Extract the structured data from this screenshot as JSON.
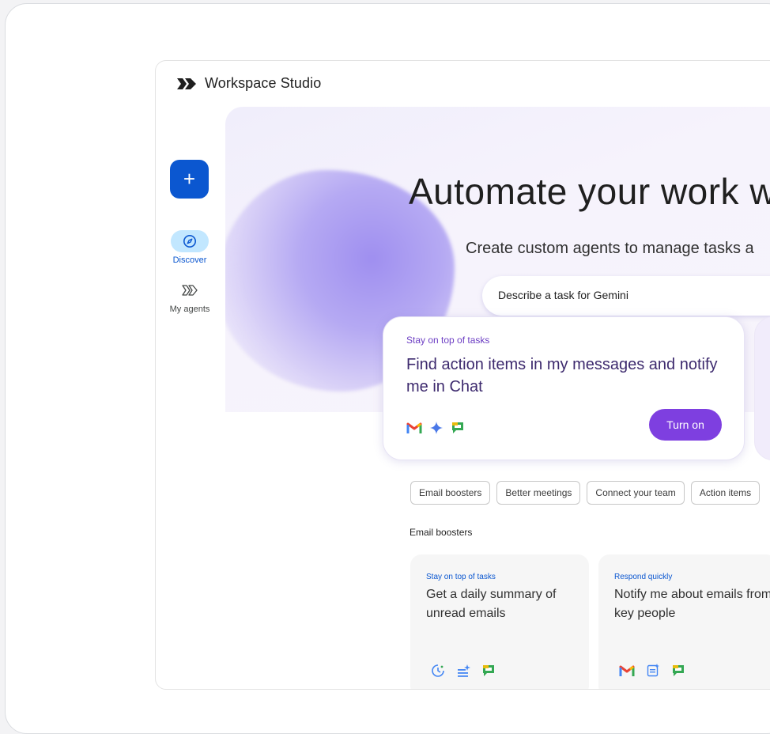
{
  "app": {
    "title": "Workspace Studio",
    "logo_icon": "workspace-studio-logo-icon"
  },
  "sidebar": {
    "create_icon": "plus-icon",
    "items": [
      {
        "label": "Discover",
        "icon": "compass-icon",
        "active": true
      },
      {
        "label": "My agents",
        "icon": "agents-icon",
        "active": false
      }
    ]
  },
  "hero": {
    "title": "Automate your work wi",
    "subtitle": "Create custom agents to manage tasks a",
    "prompt_text": "Describe a task for Gemini"
  },
  "featured": {
    "kicker": "Stay on top of tasks",
    "headline": "Find action items in my messages and notify me in Chat",
    "button_label": "Turn on",
    "icons": [
      "gmail-icon",
      "gemini-sparkle-icon",
      "google-chat-icon"
    ]
  },
  "chips": [
    "Email boosters",
    "Better meetings",
    "Connect your team",
    "Action items"
  ],
  "section": {
    "heading": "Email boosters",
    "cards": [
      {
        "kicker": "Stay on top of tasks",
        "headline": "Get a daily summary of unread emails",
        "icons": [
          "schedule-icon",
          "summary-list-icon",
          "google-chat-icon"
        ]
      },
      {
        "kicker": "Respond quickly",
        "headline": "Notify me about emails from key people",
        "icons": [
          "gmail-icon",
          "doc-sparkle-icon",
          "google-chat-icon"
        ]
      }
    ]
  },
  "colors": {
    "primary_blue": "#0b57d0",
    "accent_purple": "#7e3fe0",
    "nav_active_bg": "#c2e7ff",
    "blob_purple": "#9f8ff0"
  }
}
